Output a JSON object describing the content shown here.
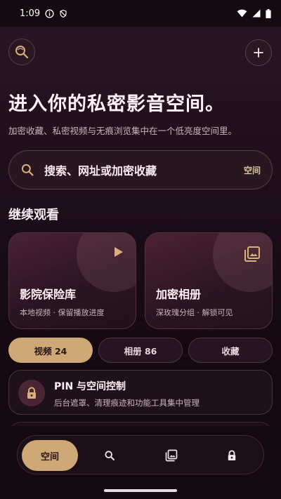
{
  "status_bar": {
    "time": "1:09"
  },
  "header": {
    "title": "进入你的私密影音空间。",
    "subtitle": "加密收藏、私密视频与无痕浏览集中在一个低亮度空间里。"
  },
  "search": {
    "placeholder": "搜索、网址或加密收藏",
    "scope_label": "空间"
  },
  "continue_section": {
    "title": "继续观看",
    "cards": [
      {
        "title": "影院保险库",
        "description": "本地视频 · 保留播放进度",
        "icon": "play-icon"
      },
      {
        "title": "加密相册",
        "description": "深玫瑰分组 · 解锁可见",
        "icon": "photo-library-icon"
      }
    ]
  },
  "tabs": [
    {
      "label": "视频 24",
      "active": true
    },
    {
      "label": "相册 86",
      "active": false
    },
    {
      "label": "收藏",
      "active": false
    }
  ],
  "control_panel": {
    "title": "PIN 与空间控制",
    "description": "后台遮罩、清理痕迹和功能工具集中管理",
    "icon": "lock-icon"
  },
  "bottom_nav": {
    "items": [
      {
        "label": "空间",
        "icon": "",
        "active": true
      },
      {
        "label": "",
        "icon": "search-icon",
        "active": false
      },
      {
        "label": "",
        "icon": "photo-library-icon",
        "active": false
      },
      {
        "label": "",
        "icon": "lock-icon",
        "active": false
      }
    ]
  },
  "colors": {
    "accent_gold": "#cfa878",
    "background": "#1d0e19",
    "card_border": "#4f3140"
  }
}
